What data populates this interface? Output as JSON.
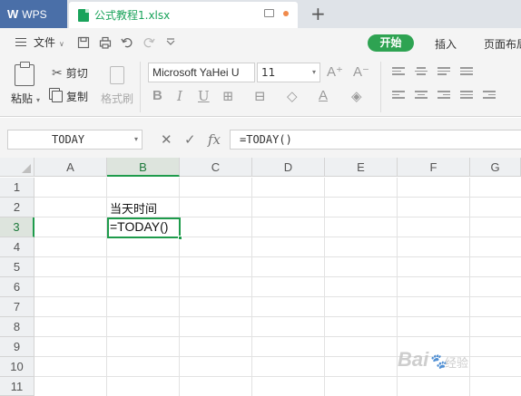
{
  "titlebar": {
    "app_name": "WPS",
    "document_tab": "公式教程1.xlsx",
    "new_tab_symbol": "+"
  },
  "menubar": {
    "file_menu": "文件",
    "start_tab": "开始",
    "insert_tab": "插入",
    "layout_tab": "页面布局"
  },
  "ribbon": {
    "paste_label": "粘贴",
    "cut_label": "剪切",
    "copy_label": "复制",
    "format_painter_label": "格式刷",
    "font_name": "Microsoft YaHei U",
    "font_size": "11"
  },
  "formula_bar": {
    "name_box": "TODAY",
    "fx_label": "fx",
    "formula": "=TODAY()"
  },
  "sheet": {
    "columns": [
      "A",
      "B",
      "C",
      "D",
      "E",
      "F",
      "G"
    ],
    "rows": [
      "1",
      "2",
      "3",
      "4",
      "5",
      "6",
      "7",
      "8",
      "9",
      "10",
      "11"
    ],
    "active_column": "B",
    "active_row": "3",
    "cells": {
      "B2": "当天时间",
      "B3": "=TODAY()"
    },
    "accent_color": "#1e9b4b"
  },
  "watermark": {
    "brand": "Bai",
    "suffix": "经验"
  }
}
